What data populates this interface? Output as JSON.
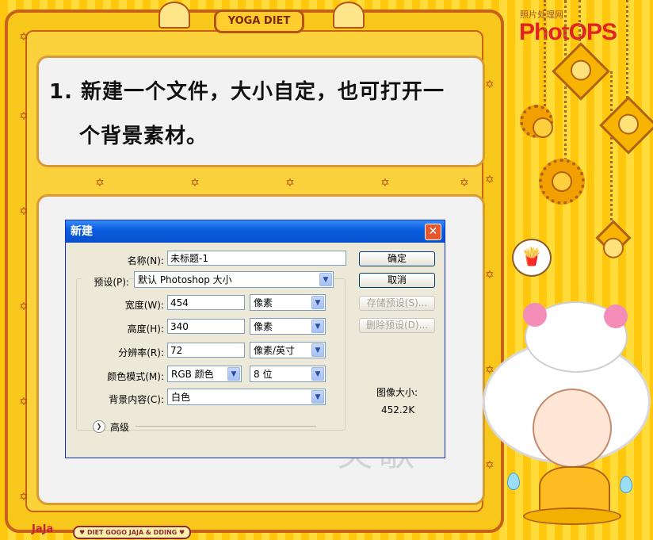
{
  "header": {
    "banner": "YOGA DIET",
    "brand_small": "照片处理网",
    "brand_logo": "PhotOPS"
  },
  "step": {
    "line1": "1. 新建一个文件，大小自定，也可打开一",
    "line2": "个背景素材。"
  },
  "dialog": {
    "title": "新建",
    "close_symbol": "✕",
    "name_label": "名称(N):",
    "name_value": "未标题-1",
    "preset_label": "预设(P):",
    "preset_value": "默认 Photoshop 大小",
    "width_label": "宽度(W):",
    "width_value": "454",
    "width_unit": "像素",
    "height_label": "高度(H):",
    "height_value": "340",
    "height_unit": "像素",
    "resolution_label": "分辨率(R):",
    "resolution_value": "72",
    "resolution_unit": "像素/英寸",
    "color_mode_label": "颜色模式(M):",
    "color_mode_value": "RGB 颜色",
    "bit_depth_value": "8 位",
    "background_label": "背景内容(C):",
    "background_value": "白色",
    "advanced_label": "高级",
    "ok_button": "确定",
    "cancel_button": "取消",
    "save_preset_button": "存储预设(S)...",
    "delete_preset_button": "删除预设(D)...",
    "image_size_label": "图像大小:",
    "image_size_value": "452.2K"
  },
  "footer": {
    "logo": "JaJa",
    "tag": "♥ DIET GOGO JAJA & DDING ♥"
  },
  "colors": {
    "background": "#ffd21a",
    "frame": "#c8611a",
    "titlebar": "#0a5ee0",
    "dialog": "#ece9d8"
  }
}
